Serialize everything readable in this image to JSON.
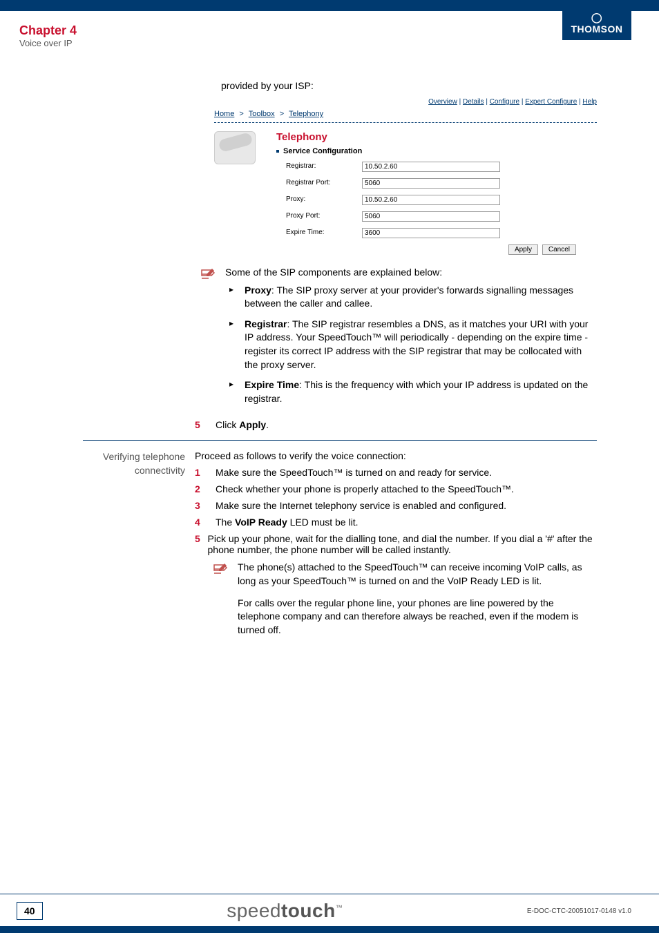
{
  "header": {
    "chapter_title": "Chapter 4",
    "chapter_sub": "Voice over IP",
    "brand": "THOMSON"
  },
  "intro": "provided by your ISP:",
  "ui": {
    "nav": [
      "Overview",
      "Details",
      "Configure",
      "Expert Configure",
      "Help"
    ],
    "breadcrumb": [
      "Home",
      "Toolbox",
      "Telephony"
    ],
    "section_title": "Telephony",
    "subhead": "Service Configuration",
    "fields": {
      "registrar": {
        "label": "Registrar:",
        "value": "10.50.2.60"
      },
      "registrar_port": {
        "label": "Registrar Port:",
        "value": "5060"
      },
      "proxy": {
        "label": "Proxy:",
        "value": "10.50.2.60"
      },
      "proxy_port": {
        "label": "Proxy Port:",
        "value": "5060"
      },
      "expire_time": {
        "label": "Expire Time:",
        "value": "3600"
      }
    },
    "apply_label": "Apply",
    "cancel_label": "Cancel"
  },
  "sip_intro": "Some of the SIP components are explained below:",
  "sip_items": {
    "proxy": {
      "term": "Proxy",
      "text": ": The SIP proxy server at your provider's forwards signalling messages between the caller and callee."
    },
    "registrar": {
      "term": "Registrar",
      "text": ": The SIP registrar resembles a DNS, as it matches your URI with your IP address. Your SpeedTouch™ will periodically - depending on the expire time - register its correct IP address with the SIP registrar that may be collocated with the proxy server."
    },
    "expire": {
      "term": "Expire Time",
      "text": ": This is the frequency with which your IP address is updated on the registrar."
    }
  },
  "step5": {
    "num": "5",
    "pre": "Click ",
    "bold": "Apply",
    "post": "."
  },
  "verify": {
    "heading": "Verifying telephone connectivity",
    "intro": "Proceed as follows to verify the voice connection:",
    "steps": {
      "s1": {
        "num": "1",
        "text": "Make sure the SpeedTouch™ is turned on and ready for service."
      },
      "s2": {
        "num": "2",
        "text": "Check whether your phone is properly attached to the SpeedTouch™."
      },
      "s3": {
        "num": "3",
        "text": "Make sure the Internet telephony service is enabled and configured."
      },
      "s4": {
        "num": "4",
        "pre": "The ",
        "bold": "VoIP Ready",
        "post": " LED must be lit."
      },
      "s5": {
        "num": "5",
        "text": "Pick up your phone, wait for the dialling tone, and dial the number. If you dial a '#' after the phone number, the phone number will be called instantly."
      }
    },
    "tip1": "The phone(s) attached to the SpeedTouch™ can receive incoming VoIP calls, as long as your SpeedTouch™ is turned on and the VoIP Ready LED is lit.",
    "tip2": "For calls over the regular phone line, your phones are line powered by the telephone company and can therefore always be reached, even if the modem is turned off."
  },
  "footer": {
    "page_num": "40",
    "brand_pre": "speed",
    "brand_bold": "touch",
    "doc_id": "E-DOC-CTC-20051017-0148 v1.0"
  }
}
